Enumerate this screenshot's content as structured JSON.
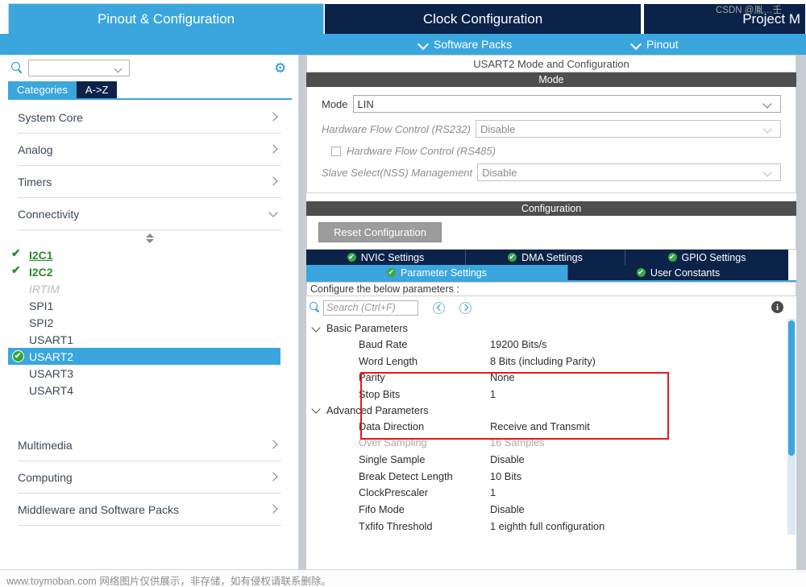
{
  "top_tabs": [
    {
      "label": "Pinout & Configuration",
      "selected": true
    },
    {
      "label": "Clock Configuration",
      "selected": false
    },
    {
      "label": "Project M",
      "selected": false
    }
  ],
  "sub_toolbar": [
    {
      "label": "Software Packs",
      "icon": "chevron-down-icon"
    },
    {
      "label": "Pinout",
      "icon": "chevron-down-icon"
    }
  ],
  "left_panel": {
    "search": {
      "value": "",
      "placeholder": ""
    },
    "gear_icon": "gear-icon",
    "view_tabs": [
      {
        "label": "Categories",
        "selected": true
      },
      {
        "label": "A->Z",
        "selected": false
      }
    ],
    "categories": [
      {
        "label": "System Core",
        "expanded": false
      },
      {
        "label": "Analog",
        "expanded": false
      },
      {
        "label": "Timers",
        "expanded": false
      },
      {
        "label": "Connectivity",
        "expanded": true
      }
    ],
    "peripherals": [
      {
        "label": "I2C1",
        "state": "enabled",
        "link": true
      },
      {
        "label": "I2C2",
        "state": "enabled",
        "link": false
      },
      {
        "label": "IRTIM",
        "state": "unavailable"
      },
      {
        "label": "SPI1",
        "state": "normal"
      },
      {
        "label": "SPI2",
        "state": "normal"
      },
      {
        "label": "USART1",
        "state": "normal"
      },
      {
        "label": "USART2",
        "state": "selected"
      },
      {
        "label": "USART3",
        "state": "normal"
      },
      {
        "label": "USART4",
        "state": "normal"
      }
    ],
    "categories_after": [
      {
        "label": "Multimedia",
        "expanded": false
      },
      {
        "label": "Computing",
        "expanded": false
      },
      {
        "label": "Middleware and Software Packs",
        "expanded": false
      }
    ]
  },
  "right_panel": {
    "title": "USART2 Mode and Configuration",
    "mode_section": {
      "header": "Mode",
      "fields": [
        {
          "label": "Mode",
          "value": "LIN",
          "type": "select",
          "disabled": false
        },
        {
          "label": "Hardware Flow Control (RS232)",
          "value": "Disable",
          "type": "select",
          "disabled": true
        },
        {
          "label": "Hardware Flow Control (RS485)",
          "value": "",
          "type": "checkbox",
          "disabled": true,
          "checked": false
        },
        {
          "label": "Slave Select(NSS) Management",
          "value": "Disable",
          "type": "select",
          "disabled": true
        }
      ]
    },
    "config_section": {
      "header": "Configuration",
      "reset_button": "Reset Configuration",
      "tabs_row1": [
        {
          "label": "NVIC Settings",
          "active": false,
          "icon": "check-circle-icon"
        },
        {
          "label": "DMA Settings",
          "active": false,
          "icon": "check-circle-icon"
        },
        {
          "label": "GPIO Settings",
          "active": false,
          "icon": "check-circle-icon"
        }
      ],
      "tabs_row2": [
        {
          "label": "Parameter Settings",
          "active": true,
          "icon": "check-circle-icon"
        },
        {
          "label": "User Constants",
          "active": false,
          "icon": "check-circle-icon"
        }
      ],
      "configure_note": "Configure the below parameters :",
      "param_search": {
        "value": "",
        "placeholder": "Search (Ctrl+F)"
      },
      "nav_prev_icon": "circle-left-arrow-icon",
      "nav_next_icon": "circle-right-arrow-icon",
      "info_icon": "info-icon",
      "groups": [
        {
          "label": "Basic Parameters",
          "expanded": true,
          "highlighted": true,
          "params": [
            {
              "key": "Baud Rate",
              "value": "19200 Bits/s",
              "disabled": false
            },
            {
              "key": "Word Length",
              "value": "8 Bits (including Parity)",
              "disabled": false
            },
            {
              "key": "Parity",
              "value": "None",
              "disabled": false
            },
            {
              "key": "Stop Bits",
              "value": "1",
              "disabled": false
            }
          ]
        },
        {
          "label": "Advanced Parameters",
          "expanded": true,
          "highlighted": false,
          "params": [
            {
              "key": "Data Direction",
              "value": "Receive and Transmit",
              "disabled": false
            },
            {
              "key": "Over Sampling",
              "value": "16 Samples",
              "disabled": true
            },
            {
              "key": "Single Sample",
              "value": "Disable",
              "disabled": false
            },
            {
              "key": "Break Detect Length",
              "value": "10 Bits",
              "disabled": false
            },
            {
              "key": "ClockPrescaler",
              "value": "1",
              "disabled": false
            },
            {
              "key": "Fifo Mode",
              "value": "Disable",
              "disabled": false
            },
            {
              "key": "Txfifo Threshold",
              "value": "1 eighth full configuration",
              "disabled": false
            }
          ]
        }
      ]
    }
  },
  "watermarks": {
    "bottom_left": "www.toymoban.com 网络图片仅供展示，非存储，如有侵权请联系删除。",
    "bottom_right": "CSDN @胤…壬"
  },
  "colors": {
    "accent_blue": "#3aa6dd",
    "dark_navy": "#0b2349",
    "green_check": "#2d8a2d",
    "highlight_red": "#e8191b",
    "section_gray": "#4e4e4e"
  }
}
